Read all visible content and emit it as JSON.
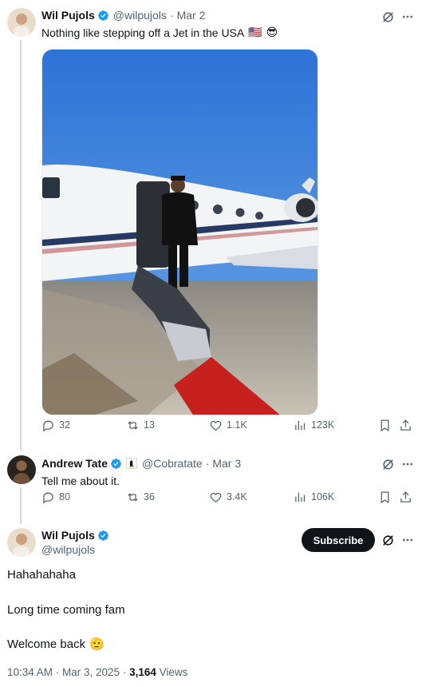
{
  "post1": {
    "author_name": "Wil Pujols",
    "handle": "@wilpujols",
    "dot": "·",
    "date": "Mar 2",
    "text": "Nothing like stepping off a Jet in the USA",
    "flag": "🇺🇸",
    "emoji": "😎",
    "stats": {
      "replies": "32",
      "reposts": "13",
      "likes": "1.1K",
      "views": "123K"
    }
  },
  "post2": {
    "author_name": "Andrew Tate",
    "handle": "@Cobratate",
    "dot": "·",
    "date": "Mar 3",
    "text": "Tell me about it.",
    "stats": {
      "replies": "80",
      "reposts": "36",
      "likes": "3.4K",
      "views": "106K"
    }
  },
  "main_post": {
    "author_name": "Wil Pujols",
    "handle": "@wilpujols",
    "subscribe_label": "Subscribe",
    "lines": [
      "Hahahahaha",
      "Long time coming fam",
      "Welcome back"
    ],
    "salute_emoji": "🫡",
    "time": "10:34 AM · Mar 3, 2025 · ",
    "views_count": "3,164",
    "views_label": " Views"
  },
  "colors": {
    "verified": "#1d9bf0",
    "muted": "#536471",
    "text": "#0f1419"
  }
}
